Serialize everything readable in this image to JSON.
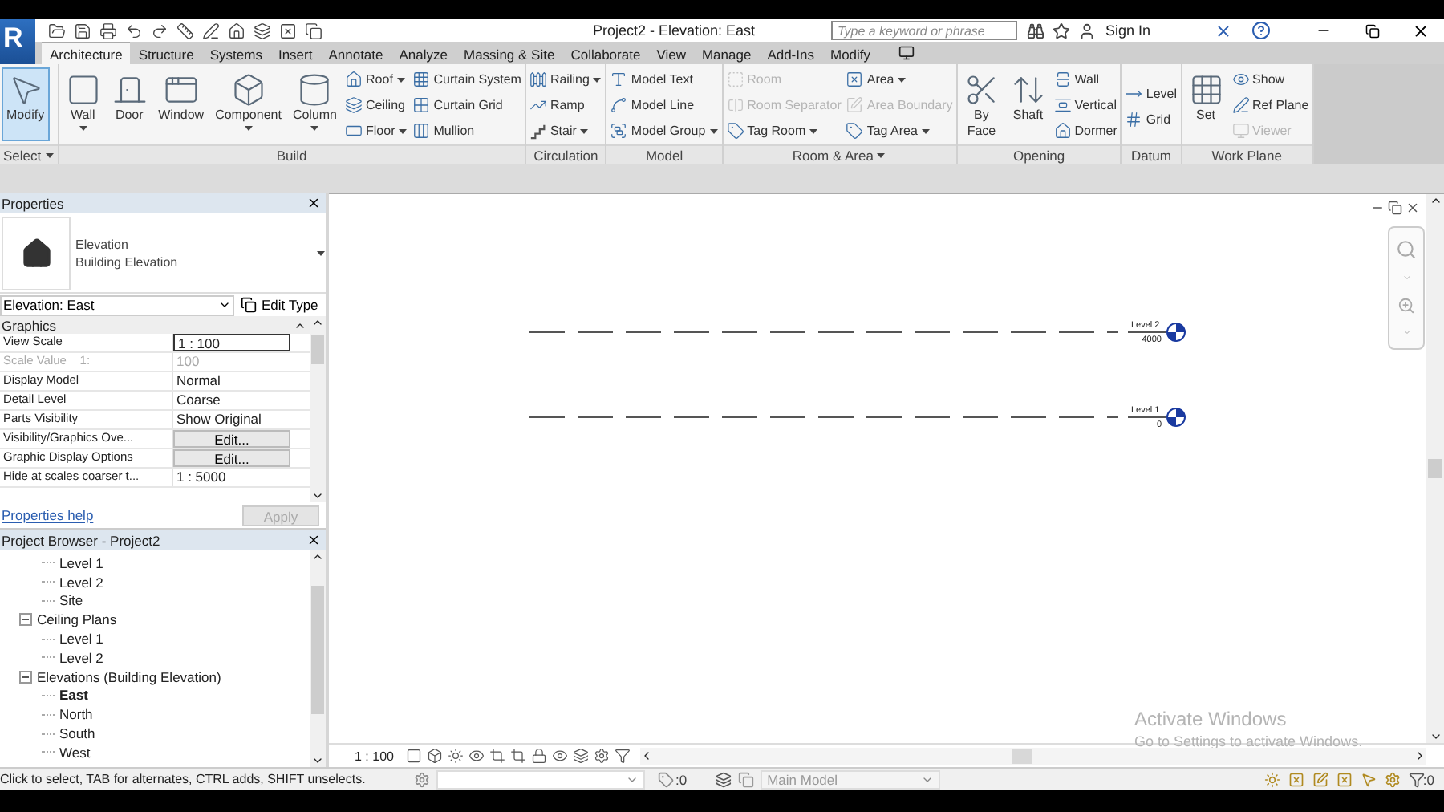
{
  "app_button": {
    "label": "R"
  },
  "title": "Project2 - Elevation: East",
  "search": {
    "placeholder": "Type a keyword or phrase"
  },
  "sign_in": {
    "label": "Sign In"
  },
  "ribbon_tabs": [
    {
      "label": "Architecture",
      "selected": true
    },
    {
      "label": "Structure",
      "selected": false
    },
    {
      "label": "Systems",
      "selected": false
    },
    {
      "label": "Insert",
      "selected": false
    },
    {
      "label": "Annotate",
      "selected": false
    },
    {
      "label": "Analyze",
      "selected": false
    },
    {
      "label": "Massing & Site",
      "selected": false
    },
    {
      "label": "Collaborate",
      "selected": false
    },
    {
      "label": "View",
      "selected": false
    },
    {
      "label": "Manage",
      "selected": false
    },
    {
      "label": "Add-Ins",
      "selected": false
    },
    {
      "label": "Modify",
      "selected": false
    }
  ],
  "ribbon_panels": [
    {
      "label": "Select",
      "dropdown": true,
      "tools": [
        {
          "label": "Modify",
          "kind": "large",
          "active": true,
          "disabled": false,
          "dropdown": false
        }
      ]
    },
    {
      "label": "Build",
      "dropdown": false,
      "tools": [
        {
          "label": "Wall",
          "kind": "large",
          "active": false,
          "disabled": false,
          "dropdown": true
        },
        {
          "label": "Door",
          "kind": "large",
          "active": false,
          "disabled": false,
          "dropdown": false
        },
        {
          "label": "Window",
          "kind": "large",
          "active": false,
          "disabled": false,
          "dropdown": false
        },
        {
          "label": "Component",
          "kind": "large",
          "active": false,
          "disabled": false,
          "dropdown": true
        },
        {
          "label": "Column",
          "kind": "large",
          "active": false,
          "disabled": false,
          "dropdown": true
        },
        {
          "label": "Roof",
          "kind": "small",
          "active": false,
          "disabled": false,
          "dropdown": true
        },
        {
          "label": "Ceiling",
          "kind": "small",
          "active": false,
          "disabled": false,
          "dropdown": false
        },
        {
          "label": "Floor",
          "kind": "small",
          "active": false,
          "disabled": false,
          "dropdown": true
        },
        {
          "label": "Curtain System",
          "kind": "small",
          "active": false,
          "disabled": false,
          "dropdown": false
        },
        {
          "label": "Curtain Grid",
          "kind": "small",
          "active": false,
          "disabled": false,
          "dropdown": false
        },
        {
          "label": "Mullion",
          "kind": "small",
          "active": false,
          "disabled": false,
          "dropdown": false
        }
      ]
    },
    {
      "label": "Circulation",
      "dropdown": false,
      "tools": [
        {
          "label": "Railing",
          "kind": "small",
          "active": false,
          "disabled": false,
          "dropdown": true
        },
        {
          "label": "Ramp",
          "kind": "small",
          "active": false,
          "disabled": false,
          "dropdown": false
        },
        {
          "label": "Stair",
          "kind": "small",
          "active": false,
          "disabled": false,
          "dropdown": true
        }
      ]
    },
    {
      "label": "Model",
      "dropdown": false,
      "tools": [
        {
          "label": "Model Text",
          "kind": "small",
          "active": false,
          "disabled": false,
          "dropdown": false
        },
        {
          "label": "Model Line",
          "kind": "small",
          "active": false,
          "disabled": false,
          "dropdown": false
        },
        {
          "label": "Model Group",
          "kind": "small",
          "active": false,
          "disabled": false,
          "dropdown": true
        }
      ]
    },
    {
      "label": "Room & Area",
      "dropdown": true,
      "tools": [
        {
          "label": "Room",
          "kind": "small",
          "active": false,
          "disabled": true,
          "dropdown": false
        },
        {
          "label": "Room Separator",
          "kind": "small",
          "active": false,
          "disabled": true,
          "dropdown": false
        },
        {
          "label": "Tag Room",
          "kind": "small",
          "active": false,
          "disabled": false,
          "dropdown": true
        },
        {
          "label": "Area",
          "kind": "small",
          "active": false,
          "disabled": false,
          "dropdown": true
        },
        {
          "label": "Area Boundary",
          "kind": "small",
          "active": false,
          "disabled": true,
          "dropdown": false
        },
        {
          "label": "Tag Area",
          "kind": "small",
          "active": false,
          "disabled": false,
          "dropdown": true
        }
      ]
    },
    {
      "label": "Opening",
      "dropdown": false,
      "tools": [
        {
          "label": "By Face",
          "kind": "large",
          "active": false,
          "disabled": false,
          "dropdown": false
        },
        {
          "label": "Shaft",
          "kind": "large",
          "active": false,
          "disabled": false,
          "dropdown": false
        },
        {
          "label": "Wall",
          "kind": "small",
          "active": false,
          "disabled": false,
          "dropdown": false
        },
        {
          "label": "Vertical",
          "kind": "small",
          "active": false,
          "disabled": false,
          "dropdown": false
        },
        {
          "label": "Dormer",
          "kind": "small",
          "active": false,
          "disabled": false,
          "dropdown": false
        }
      ]
    },
    {
      "label": "Datum",
      "dropdown": false,
      "tools": [
        {
          "label": "Level",
          "kind": "small",
          "active": false,
          "disabled": false,
          "dropdown": false
        },
        {
          "label": "Grid",
          "kind": "small",
          "active": false,
          "disabled": false,
          "dropdown": false
        }
      ]
    },
    {
      "label": "Work Plane",
      "dropdown": false,
      "tools": [
        {
          "label": "Set",
          "kind": "large",
          "active": false,
          "disabled": false,
          "dropdown": false
        },
        {
          "label": "Show",
          "kind": "small",
          "active": false,
          "disabled": false,
          "dropdown": false
        },
        {
          "label": "Ref Plane",
          "kind": "small",
          "active": false,
          "disabled": false,
          "dropdown": false
        },
        {
          "label": "Viewer",
          "kind": "small",
          "active": false,
          "disabled": true,
          "dropdown": false
        }
      ]
    }
  ],
  "properties": {
    "title": "Properties",
    "family": "Elevation",
    "type": "Building Elevation",
    "instance": "Elevation: East",
    "edit_type": "Edit Type",
    "group": "Graphics",
    "rows": [
      {
        "name": "View Scale",
        "value": "1 : 100",
        "kind": "field",
        "disabled": false
      },
      {
        "name": "Scale Value    1:",
        "value": "100",
        "kind": "text",
        "disabled": true
      },
      {
        "name": "Display Model",
        "value": "Normal",
        "kind": "text",
        "disabled": false
      },
      {
        "name": "Detail Level",
        "value": "Coarse",
        "kind": "text",
        "disabled": false
      },
      {
        "name": "Parts Visibility",
        "value": "Show Original",
        "kind": "text",
        "disabled": false
      },
      {
        "name": "Visibility/Graphics Ove...",
        "value": "Edit...",
        "kind": "button",
        "disabled": false
      },
      {
        "name": "Graphic Display Options",
        "value": "Edit...",
        "kind": "button",
        "disabled": false
      },
      {
        "name": "Hide at scales coarser t...",
        "value": "1 : 5000",
        "kind": "text",
        "disabled": false
      }
    ],
    "help": "Properties help",
    "apply": {
      "label": "Apply",
      "disabled": true
    }
  },
  "project_browser": {
    "title": "Project Browser - Project2",
    "tree": [
      {
        "children": [
          {
            "label": "Level 1",
            "selected": false
          },
          {
            "label": "Level 2",
            "selected": false
          },
          {
            "label": "Site",
            "selected": false
          }
        ]
      },
      {
        "label": "Ceiling Plans",
        "expanded": true,
        "selected": false,
        "children": [
          {
            "label": "Level 1",
            "selected": false
          },
          {
            "label": "Level 2",
            "selected": false
          }
        ]
      },
      {
        "label": "Elevations (Building Elevation)",
        "expanded": true,
        "selected": false,
        "children": [
          {
            "label": "East",
            "selected": true
          },
          {
            "label": "North",
            "selected": false
          },
          {
            "label": "South",
            "selected": false
          },
          {
            "label": "West",
            "selected": false
          }
        ]
      }
    ]
  },
  "canvas": {
    "levels": [
      {
        "name": "Level 2",
        "elevation": "4000"
      },
      {
        "name": "Level 1",
        "elevation": "0"
      }
    ],
    "scale": "1 : 100"
  },
  "activation_notice": {
    "title": "Activate Windows",
    "text": "Go to Settings to activate Windows."
  },
  "status_bar": {
    "message": "Click to select, TAB for alternates, CTRL adds, SHIFT unselects.",
    "workset_count": ":0",
    "model": "Main Model",
    "filter_count": ":0"
  }
}
